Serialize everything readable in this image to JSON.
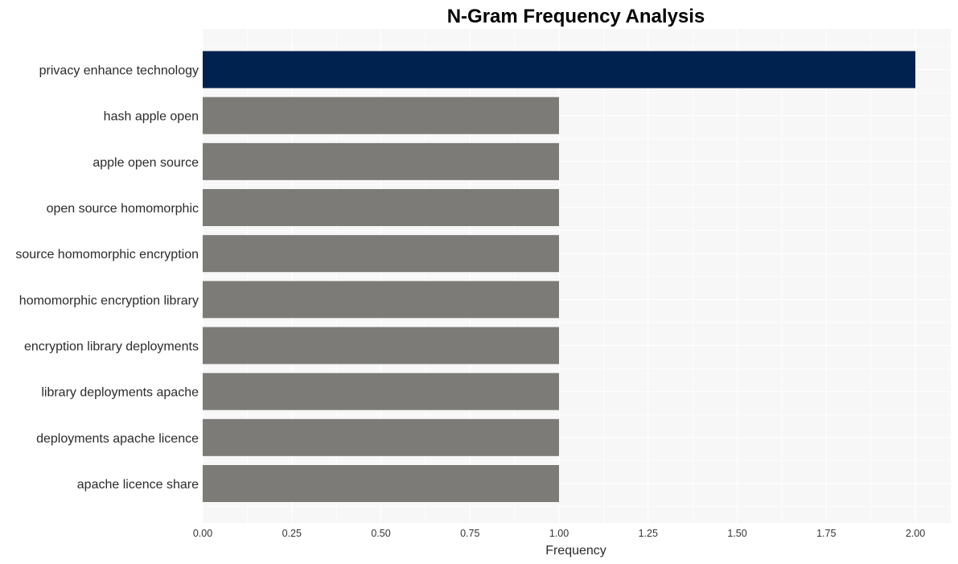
{
  "chart_data": {
    "type": "bar",
    "orientation": "horizontal",
    "title": "N-Gram Frequency Analysis",
    "xlabel": "Frequency",
    "ylabel": "",
    "xlim": [
      0,
      2.1
    ],
    "xticks": [
      0,
      0.25,
      0.5,
      0.75,
      1.0,
      1.25,
      1.5,
      1.75,
      2.0
    ],
    "xtick_labels": [
      "0.00",
      "0.25",
      "0.50",
      "0.75",
      "1.00",
      "1.25",
      "1.50",
      "1.75",
      "2.00"
    ],
    "grid": true,
    "legend": "none",
    "categories": [
      "privacy enhance technology",
      "hash apple open",
      "apple open source",
      "open source homomorphic",
      "source homomorphic encryption",
      "homomorphic encryption library",
      "encryption library deployments",
      "library deployments apache",
      "deployments apache licence",
      "apache licence share"
    ],
    "values": [
      2,
      1,
      1,
      1,
      1,
      1,
      1,
      1,
      1,
      1
    ],
    "colors": {
      "highlight": "#00224e",
      "default": "#7c7b78",
      "panel_background": "#f7f7f7",
      "grid": "#ffffff"
    }
  }
}
